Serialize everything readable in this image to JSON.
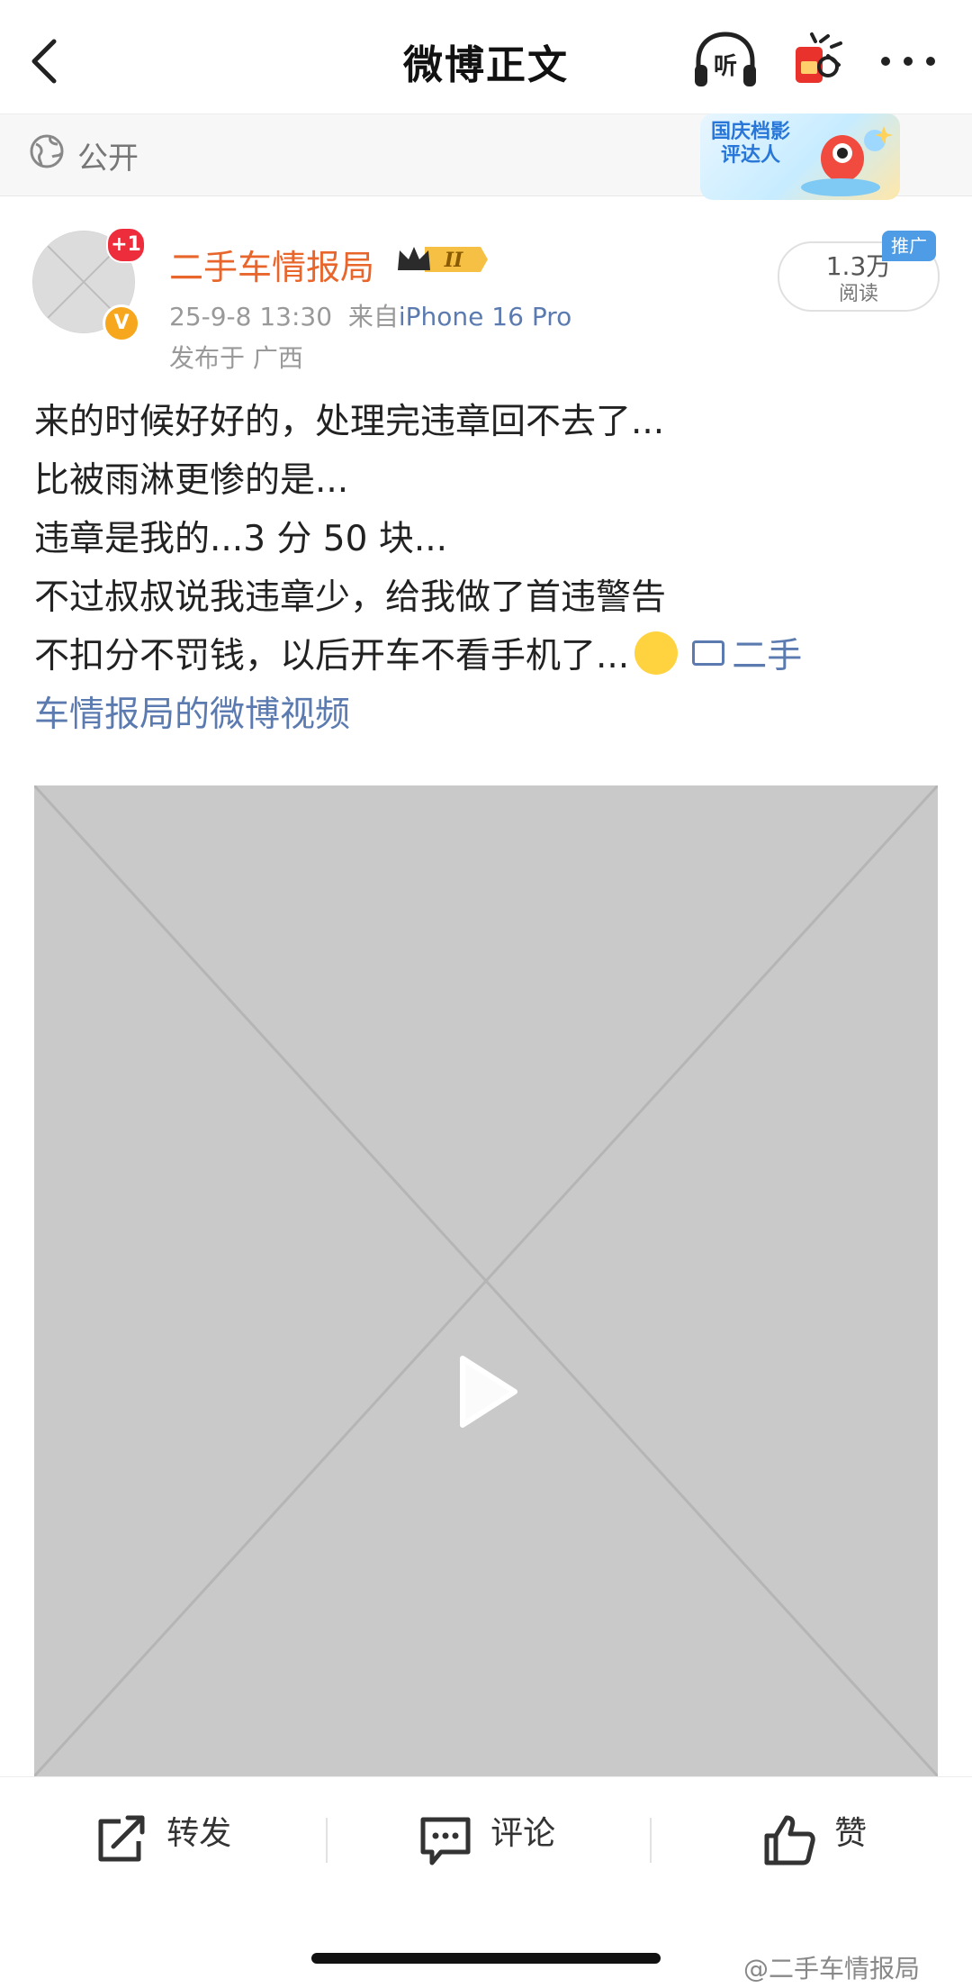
{
  "header": {
    "title": "微博正文",
    "listen_label": "听"
  },
  "visibility": {
    "label": "公开"
  },
  "badge": {
    "text": "国庆档影评达人"
  },
  "post": {
    "avatar_plus": "+1",
    "verified_mark": "V",
    "author": "二手车情报局",
    "rank_badge": "II",
    "date": "25-9-8 13:30",
    "from_label": "来自",
    "device": "iPhone 16 Pro",
    "location": "发布于 广西",
    "reads": "1.3万",
    "reads_label": "阅读",
    "promo_tag": "推广",
    "lines": [
      "来的时候好好的，处理完违章回不去了...",
      "比被雨淋更惨的是...",
      "违章是我的...3 分 50 块...",
      "不过叔叔说我违章少，给我做了首违警告",
      "不扣分不罚钱，以后开车不看手机了..."
    ],
    "video_link_a": "二手",
    "video_link_b": "车情报局的微博视频"
  },
  "actions": {
    "repost": "转发",
    "comment": "评论",
    "like": "赞"
  },
  "watermark": "@二手车情报局",
  "colors": {
    "username": "#e8652b",
    "link": "#5b7bb0",
    "promo": "#4e9be6"
  }
}
